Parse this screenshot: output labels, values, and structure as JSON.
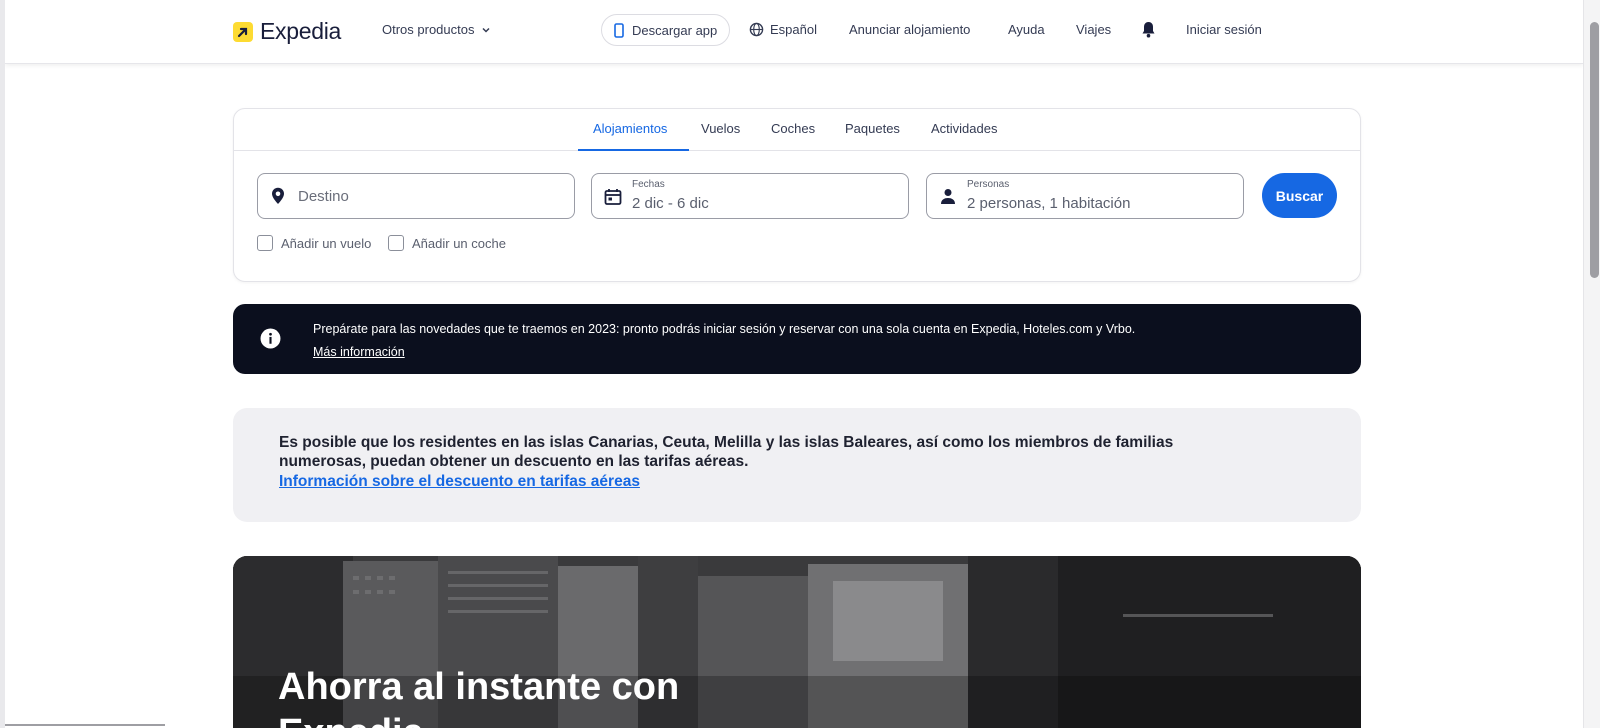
{
  "header": {
    "logo_text": "Expedia",
    "other_products": "Otros productos",
    "download_app": "Descargar app",
    "language": "Español",
    "list_property": "Anunciar alojamiento",
    "help": "Ayuda",
    "trips": "Viajes",
    "notifications_icon": "bell-icon",
    "sign_in": "Iniciar sesión"
  },
  "search": {
    "tabs": [
      "Alojamientos",
      "Vuelos",
      "Coches",
      "Paquetes",
      "Actividades"
    ],
    "active_tab": "Alojamientos",
    "destination_placeholder": "Destino",
    "dates_label": "Fechas",
    "dates_value": "2 dic - 6 dic",
    "travelers_label": "Personas",
    "travelers_value": "2 personas, 1 habitación",
    "search_button": "Buscar",
    "add_flight": "Añadir un vuelo",
    "add_car": "Añadir un coche"
  },
  "banner": {
    "text": "Prepárate para las novedades que te traemos en 2023: pronto podrás iniciar sesión y reservar con una sola cuenta en Expedia, Hoteles.com y Vrbo.",
    "link": "Más información"
  },
  "notice": {
    "text": "Es posible que los residentes en las islas Canarias, Ceuta, Melilla y las islas Baleares, así como los miembros de familias numerosas, puedan obtener un descuento en las tarifas aéreas.",
    "link": "Información sobre el descuento en tarifas aéreas"
  },
  "hero": {
    "title": "Ahorra al instante con Expedia"
  },
  "colors": {
    "accent": "#1668e3",
    "brand_yellow": "#fddb32",
    "banner_bg": "#0b0f1e"
  }
}
